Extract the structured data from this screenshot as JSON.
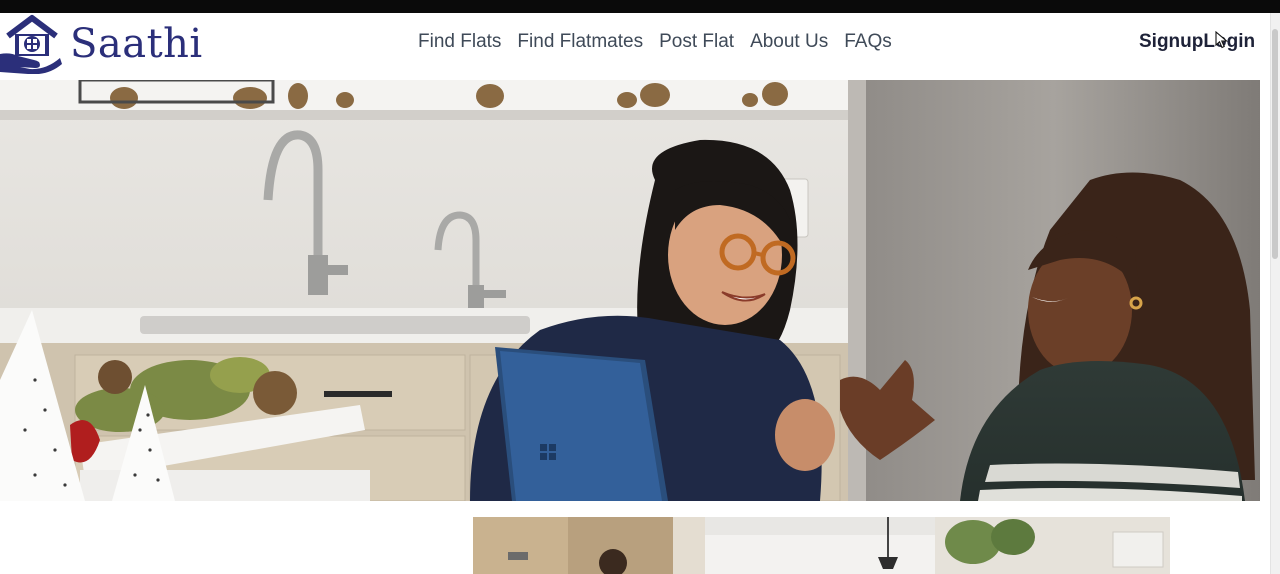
{
  "brand": {
    "name": "Saathi",
    "logo_icon": "house-in-hand-icon",
    "color": "#2b2f7a"
  },
  "nav": {
    "items": [
      {
        "label": "Find Flats"
      },
      {
        "label": "Find Flatmates"
      },
      {
        "label": "Post Flat"
      },
      {
        "label": "About Us"
      },
      {
        "label": "FAQs"
      }
    ]
  },
  "auth": {
    "signup_label": "Signup",
    "login_label": "Login"
  },
  "hero": {
    "image_icon": "hero-photo-two-women-in-kitchen-with-laptop"
  },
  "thumbnails": {
    "image_icon": "room-photo-thumbnails"
  },
  "colors": {
    "nav_text": "#3f4a58",
    "auth_text": "#1e2238",
    "background": "#ffffff"
  }
}
